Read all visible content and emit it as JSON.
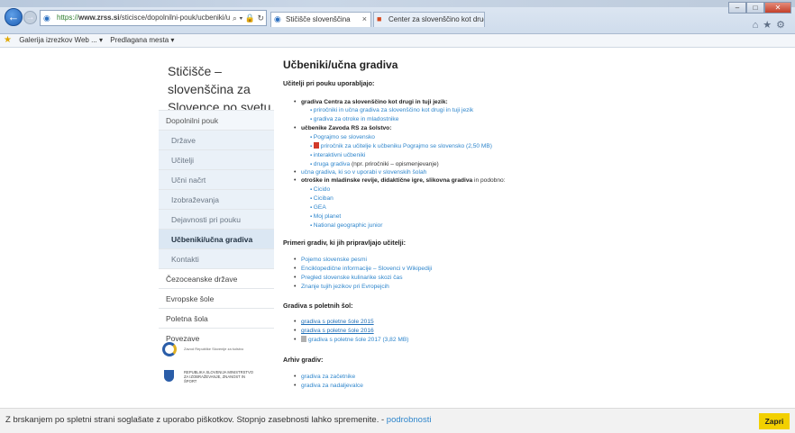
{
  "browser": {
    "url_secure": "https://",
    "url_host": "www.zrss.si",
    "url_path": "/sticisce/dopolnilni-pouk/ucbeniki/ucna-g",
    "url_controls": "⌕ ▾ 🔒 ↻",
    "tabs": [
      {
        "title": "Stičišče slovenščina",
        "close": "×"
      },
      {
        "title": "Center za slovenščino kot drug...",
        "close": ""
      }
    ],
    "window_controls": {
      "minimize": "–",
      "maximize": "□",
      "close": "✕"
    },
    "favorites": [
      {
        "label": "Galerija izrezkov Web ... ▾"
      },
      {
        "label": "Predlagana mesta ▾"
      }
    ]
  },
  "sidebar": {
    "site_title": "Stičišče – slovenščina za Slovence po svetu",
    "items": [
      {
        "label": "Dopolnilni pouk"
      },
      {
        "label": "Države"
      },
      {
        "label": "Učitelji"
      },
      {
        "label": "Učni načrt"
      },
      {
        "label": "Izobraževanja"
      },
      {
        "label": "Dejavnosti pri pouku"
      },
      {
        "label": "Učbeniki/učna gradiva"
      },
      {
        "label": "Kontakti"
      },
      {
        "label": "Čezoceanske države"
      },
      {
        "label": "Evropske šole"
      },
      {
        "label": "Poletna šola"
      },
      {
        "label": "Povezave"
      }
    ],
    "logo1_text": "Zavod Republike Slovenije za šolstvo",
    "logo2_text": "REPUBLIKA SLOVENIJA MINISTRSTVO ZA IZOBRAŽEVANJE, ZNANOST IN ŠPORT"
  },
  "content": {
    "title": "Učbeniki/učna gradiva",
    "intro": "Učitelji pri pouku uporabljajo:",
    "l1_center": "gradiva Centra za slovenščino kot drugi in tuji jezik:",
    "l1_center_a": "priročniki in učna gradiva za slovenščino kot drugi in tuji jezik",
    "l1_center_b": "gradiva za otroke in mladostnike",
    "l1_zavod": "učbenike Zavoda RS za šolstvo:",
    "l1_zavod_a": "Pograjmo se slovensko",
    "l1_zavod_b": "priročnik za učitelje k učbeniku Pograjmo se slovensko (2,50 MB)",
    "l1_zavod_c": "interaktivni učbeniki",
    "l1_zavod_d_link": "druga gradiva",
    "l1_zavod_d_rest": " (npr. priročniki – opismenjevanje)",
    "l1_ucna": "učna gradiva, ki so v uporabi v slovenskih šolah",
    "l1_revije_bold": "otroške in mladinske revije, didaktične igre, slikovna gradiva",
    "l1_revije_rest": " in podobno:",
    "revije": [
      "Cicido",
      "Ciciban",
      "GEA",
      "Moj planet",
      "National geographic junior"
    ],
    "sect2": "Primeri gradiv, ki jih pripravljajo učitelji:",
    "primeri": [
      "Pojemo slovenske pesmi",
      "Enciklopedične informacije – Slovenci v Wikipediji",
      "Pregled slovenske kulinarike skozi čas",
      "Znanje tujih jezikov pri Evropejcih"
    ],
    "sect3": "Gradiva s poletnih šol:",
    "poletne_a": "gradiva s poletne šole 2015",
    "poletne_b": "gradiva s poletne šole 2016",
    "poletne_c": "gradiva s poletne šole 2017 (3,82 MB)",
    "sect4": "Arhiv gradiv:",
    "arhiv": [
      "gradiva za začetnike",
      "gradiva za nadaljevalce"
    ]
  },
  "cookie": {
    "text": "Z brskanjem po spletni strani soglašate z uporabo piškotkov. Stopnjo zasebnosti lahko spremenite. - ",
    "link": "podrobnosti",
    "button": "Zapri"
  }
}
